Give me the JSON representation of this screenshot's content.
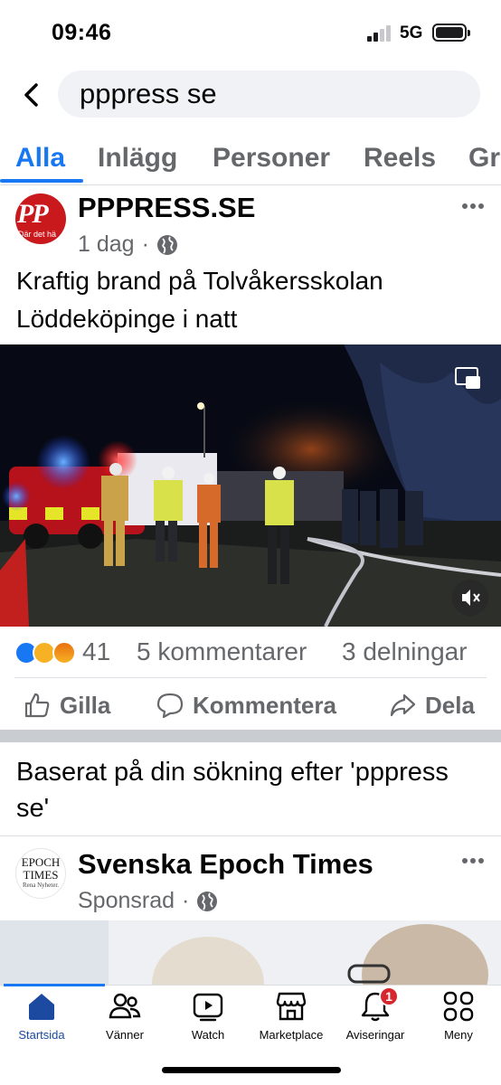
{
  "status_bar": {
    "time": "09:46",
    "network": "5G"
  },
  "search": {
    "query": "pppress se"
  },
  "tabs": [
    {
      "label": "Alla"
    },
    {
      "label": "Inlägg"
    },
    {
      "label": "Personer"
    },
    {
      "label": "Reels"
    },
    {
      "label": "Gr"
    }
  ],
  "post": {
    "page_name": "PPPRESS.SE",
    "avatar_text": "PP",
    "avatar_subtext": "Där det hä",
    "time_ago": "1 dag",
    "separator": "·",
    "text": "Kraftig brand på Tolvåkersskolan Löddeköpinge i natt",
    "reaction_count": "41",
    "comments": "5 kommentarer",
    "shares": "3 delningar",
    "actions": {
      "like": "Gilla",
      "comment": "Kommentera",
      "share": "Dela"
    }
  },
  "suggestion": {
    "text": "Baserat på din sökning efter 'pppress se'"
  },
  "sponsored": {
    "page_name": "Svenska Epoch Times",
    "avatar_line1": "EPOCH",
    "avatar_line2": "TIMES",
    "avatar_tagline": "Rena Nyheter.",
    "label": "Sponsrad",
    "separator": "·"
  },
  "bottom_nav": [
    {
      "label": "Startsida"
    },
    {
      "label": "Vänner"
    },
    {
      "label": "Watch"
    },
    {
      "label": "Marketplace"
    },
    {
      "label": "Aviseringar",
      "badge": "1"
    },
    {
      "label": "Meny"
    }
  ],
  "colors": {
    "accent": "#1877f2",
    "badge": "#d7262e",
    "secondary_text": "#65676b"
  }
}
